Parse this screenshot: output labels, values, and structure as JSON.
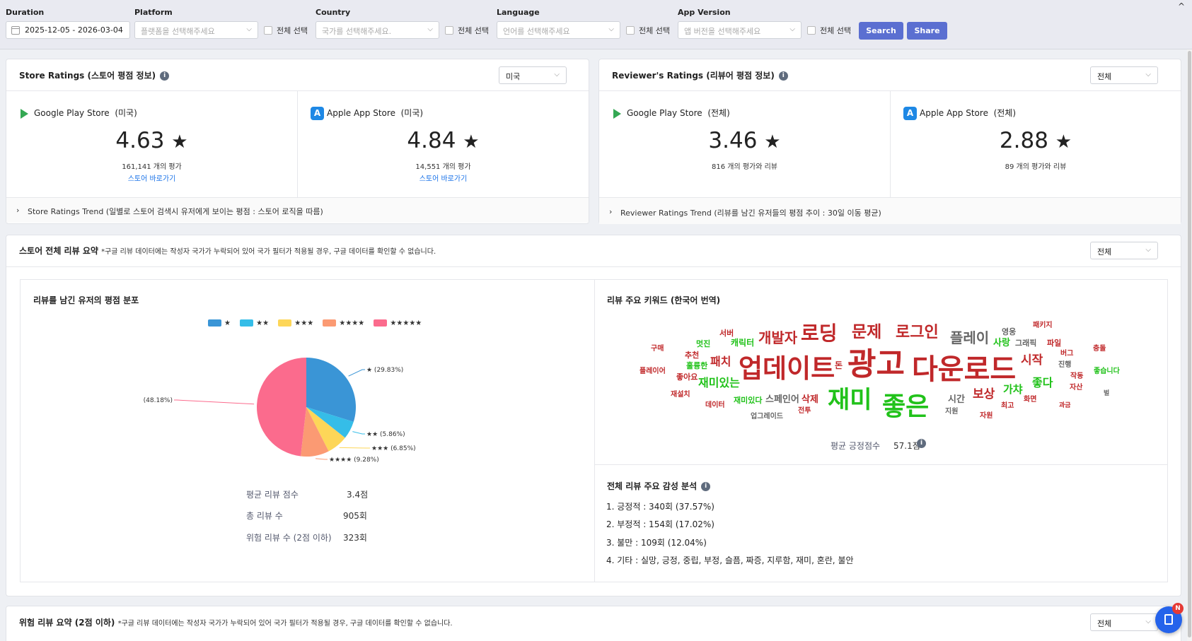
{
  "filters": {
    "duration": {
      "label": "Duration",
      "value": "2025-12-05  -  2026-03-04"
    },
    "platform": {
      "label": "Platform",
      "placeholder": "플랫폼을 선택해주세요"
    },
    "country": {
      "label": "Country",
      "placeholder": "국가를 선택해주세요."
    },
    "language": {
      "label": "Language",
      "placeholder": "언어를 선택해주세요"
    },
    "app_version": {
      "label": "App Version",
      "placeholder": "앱 버전을 선택해주세요"
    },
    "select_all": "전체 선택",
    "search_label": "Search",
    "share_label": "Share"
  },
  "store_ratings": {
    "title": "Store Ratings (스토어 평점 정보)",
    "country_select": "미국",
    "google": {
      "name": "Google Play Store",
      "region": "(미국)",
      "score": "4.63",
      "count": "161,141 개의 평가",
      "link": "스토어 바로가기"
    },
    "apple": {
      "name": "Apple App Store",
      "region": "(미국)",
      "score": "4.84",
      "count": "14,551 개의 평가",
      "link": "스토어 바로가기"
    },
    "trend": "Store Ratings Trend (일별로 스토어 검색시 유저에게 보이는 평점 : 스토어 로직을 따름)"
  },
  "reviewer_ratings": {
    "title": "Reviewer's Ratings (리뷰어 평점 정보)",
    "select": "전체",
    "google": {
      "name": "Google Play Store",
      "region": "(전체)",
      "score": "3.46",
      "count": "816 개의 평가와 리뷰"
    },
    "apple": {
      "name": "Apple App Store",
      "region": "(전체)",
      "score": "2.88",
      "count": "89 개의 평가와 리뷰"
    },
    "trend": "Reviewer Ratings Trend (리뷰를 남긴 유저들의 평점 추이 : 30일 이동 평균)"
  },
  "summary": {
    "title": "스토어 전체 리뷰 요약",
    "note": "*구글 리뷰 데이터에는 작성자 국가가 누락되어 있어 국가 필터가 적용될 경우, 구글 데이터를 확인할 수 없습니다.",
    "select": "전체",
    "dist_title": "리뷰를 남긴 유저의 평점 분포",
    "stats": [
      {
        "label": "평균 리뷰 점수",
        "value": "3.4점"
      },
      {
        "label": "총 리뷰 수",
        "value": "905회"
      },
      {
        "label": "위험 리뷰 수 (2점 이하)",
        "value": "323회"
      }
    ],
    "keywords_title": "리뷰 주요 키워드 (한국어 번역)",
    "avg_positive_label": "평균 긍정점수",
    "avg_positive_value": "57.1점",
    "sentiment_title": "전체 리뷰 주요 감성 분석",
    "sentiment": [
      "1. 긍정적 : 340회 (37.57%)",
      "2. 부정적 : 154회 (17.02%)",
      "3. 불만 : 109회 (12.04%)",
      "4. 기타 : 실망, 긍정, 중립, 부정, 슬픔, 짜증, 지루함, 재미, 혼란, 불안"
    ]
  },
  "chart_data": {
    "type": "pie",
    "categories": [
      "★",
      "★★",
      "★★★",
      "★★★★",
      "★★★★★"
    ],
    "values": [
      29.83,
      5.86,
      6.85,
      9.28,
      48.18
    ],
    "colors": [
      "#3a95d6",
      "#35bde8",
      "#fdd658",
      "#fb9a73",
      "#fb6b8d"
    ],
    "slice_labels": [
      "★ (29.83%)",
      "★★ (5.86%)",
      "★★★ (6.85%)",
      "★★★★ (9.28%)",
      "★★★★★ (48.18%)"
    ]
  },
  "keywords": {
    "positive_color": "#21c21a",
    "negative_color": "#c0282a",
    "neutral_color": "#666666",
    "words": [
      "업데이트",
      "광고",
      "다운로드",
      "재미",
      "좋은",
      "로딩",
      "문제",
      "로그인",
      "개발자",
      "플레이",
      "재미있는",
      "시작",
      "보상",
      "패치",
      "좋다",
      "가챠",
      "사랑",
      "캐릭터",
      "서버",
      "멋진",
      "추천",
      "훌륭한",
      "좋아요",
      "구매",
      "플레이어",
      "재설치",
      "데이터",
      "재미있다",
      "스페인어",
      "삭제",
      "전투",
      "업그레이드",
      "시간",
      "지원",
      "자원",
      "최고",
      "화면",
      "영웅",
      "그래픽",
      "패키지",
      "파일",
      "버그",
      "진행",
      "작동",
      "자산",
      "충돌",
      "좋습니다",
      "벌",
      "과금",
      "돈"
    ]
  },
  "danger": {
    "title": "위험 리뷰 요약 (2점 이하)",
    "note": "*구글 리뷰 데이터에는 작성자 국가가 누락되어 있어 국가 필터가 적용될 경우, 구글 데이터를 확인할 수 없습니다.",
    "select": "전체"
  },
  "fab_badge": "N"
}
